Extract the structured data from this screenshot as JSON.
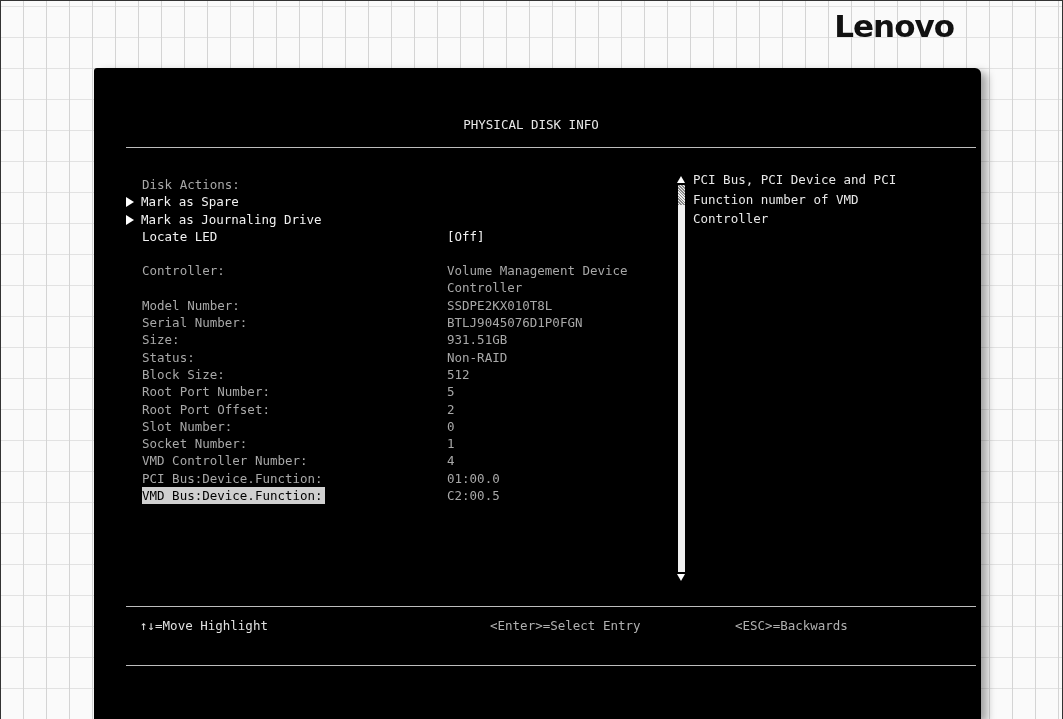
{
  "logo": {
    "text": "Lenovo"
  },
  "screen": {
    "title": "PHYSICAL DISK INFO"
  },
  "items": [
    {
      "kind": "heading",
      "label": "Disk Actions:"
    },
    {
      "kind": "action",
      "label": "Mark as Spare",
      "selected": false
    },
    {
      "kind": "action",
      "label": "Mark as Journaling Drive",
      "selected": false
    },
    {
      "kind": "option",
      "label": "Locate LED",
      "value": "[Off]",
      "selected": false
    },
    {
      "kind": "info",
      "label": "Controller:",
      "value": "Volume Management Device Controller",
      "selected": false
    },
    {
      "kind": "info",
      "label": "Model Number:",
      "value": "SSDPE2KX010T8L",
      "selected": false
    },
    {
      "kind": "info",
      "label": "Serial Number:",
      "value": "BTLJ9045076D1P0FGN",
      "selected": false
    },
    {
      "kind": "info",
      "label": "Size:",
      "value": "931.51GB",
      "selected": false
    },
    {
      "kind": "info",
      "label": "Status:",
      "value": "Non-RAID",
      "selected": false
    },
    {
      "kind": "info",
      "label": "Block Size:",
      "value": "512",
      "selected": false
    },
    {
      "kind": "info",
      "label": "Root Port Number:",
      "value": "5",
      "selected": false
    },
    {
      "kind": "info",
      "label": "Root Port Offset:",
      "value": "2",
      "selected": false
    },
    {
      "kind": "info",
      "label": "Slot Number:",
      "value": "0",
      "selected": false
    },
    {
      "kind": "info",
      "label": "Socket Number:",
      "value": "1",
      "selected": false
    },
    {
      "kind": "info",
      "label": "VMD Controller Number:",
      "value": "4",
      "selected": false
    },
    {
      "kind": "info",
      "label": "PCI Bus:Device.Function:",
      "value": "01:00.0",
      "selected": false
    },
    {
      "kind": "info",
      "label": "VMD Bus:Device.Function:",
      "value": "C2:00.5",
      "selected": true
    }
  ],
  "help": {
    "text": "PCI Bus, PCI Device and PCI Function number of VMD Controller"
  },
  "footer": [
    "↑↓=Move Highlight",
    "<Enter>=Select Entry",
    "<ESC>=Backwards"
  ]
}
